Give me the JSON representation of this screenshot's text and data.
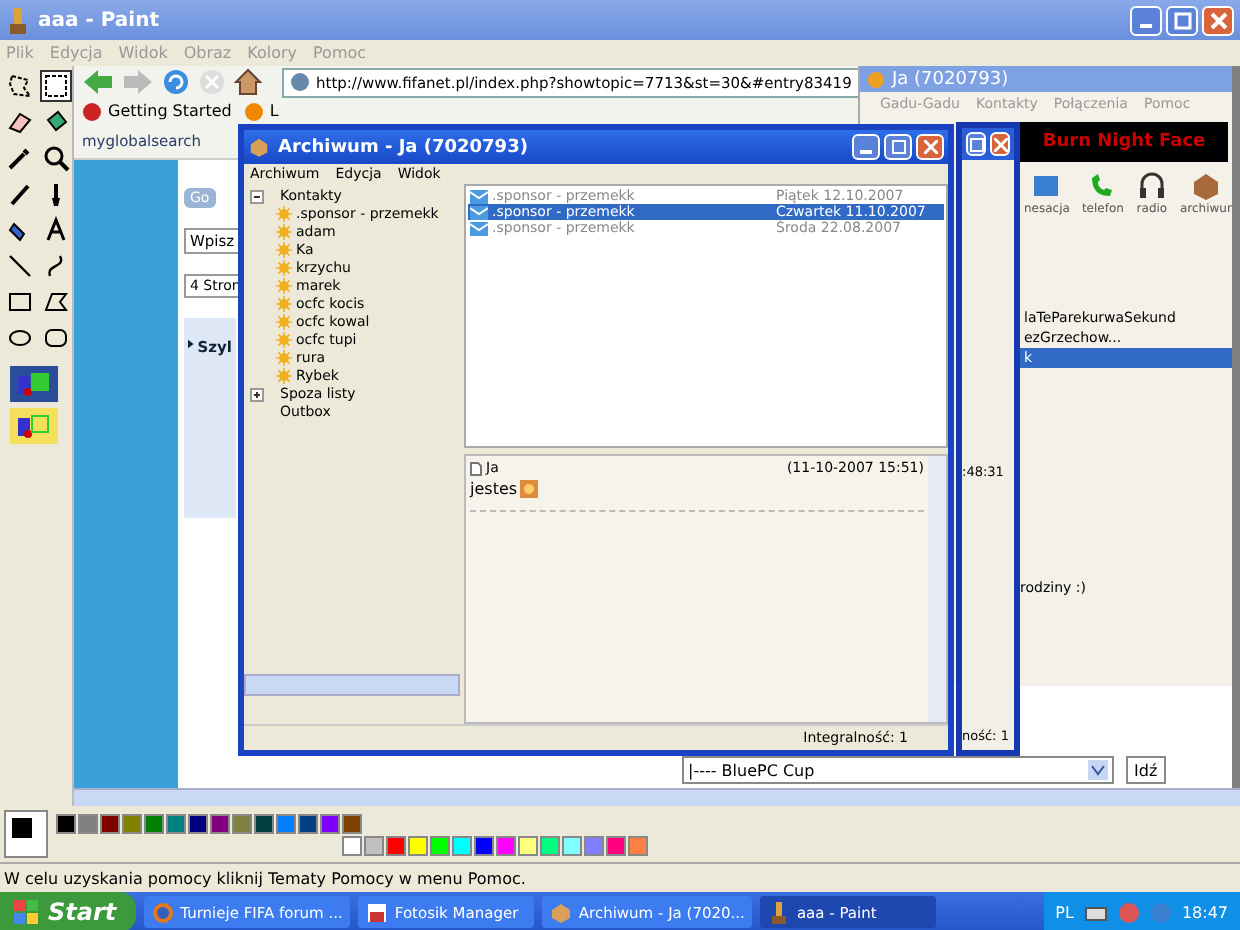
{
  "window": {
    "title": "aaa - Paint"
  },
  "menu": [
    "Plik",
    "Edycja",
    "Widok",
    "Obraz",
    "Kolory",
    "Pomoc"
  ],
  "tools": [
    {
      "kind": "free-select",
      "selected": false
    },
    {
      "kind": "select",
      "selected": true
    },
    {
      "kind": "eraser",
      "selected": false
    },
    {
      "kind": "fill",
      "selected": false
    },
    {
      "kind": "picker",
      "selected": false
    },
    {
      "kind": "magnifier",
      "selected": false
    },
    {
      "kind": "pencil",
      "selected": false
    },
    {
      "kind": "brush",
      "selected": false
    },
    {
      "kind": "airbrush",
      "selected": false
    },
    {
      "kind": "text",
      "selected": false
    },
    {
      "kind": "line",
      "selected": false
    },
    {
      "kind": "curve",
      "selected": false
    },
    {
      "kind": "rectangle",
      "selected": false
    },
    {
      "kind": "polygon",
      "selected": false
    },
    {
      "kind": "ellipse",
      "selected": false
    },
    {
      "kind": "rounded-rectangle",
      "selected": false
    }
  ],
  "transparency": [
    {
      "selected": true
    },
    {
      "selected": false
    }
  ],
  "canvas": {
    "browser": {
      "url": "http://www.fifanet.pl/index.php?showtopic=7713&st=30&#entry83419",
      "bookmarks": [
        {
          "label": "Getting Started"
        },
        {
          "label": "L"
        }
      ],
      "search_logo": "myglobalsearch",
      "go_button": "Go",
      "input_value": "Wpisz",
      "pages": "4 Stron",
      "heading": "Szyl",
      "forum_select": "|---- BluePC Cup",
      "jump_button": "Idź"
    },
    "gg_window": {
      "title": "Ja (7020793)",
      "menu": [
        "Gadu-Gadu",
        "Kontakty",
        "Połączenia",
        "Pomoc"
      ],
      "banner": "Burn Night Face",
      "toolbar": [
        {
          "label": "nesacja",
          "kind": "contacts"
        },
        {
          "label": "telefon",
          "kind": "phone"
        },
        {
          "label": "radio",
          "kind": "radio"
        },
        {
          "label": "archiwur",
          "kind": "archive"
        }
      ],
      "list": [
        {
          "name": "laTeParekurwaSekund",
          "selected": false
        },
        {
          "name": "ezGrzechow...",
          "selected": false
        },
        {
          "name": "k",
          "selected": true
        }
      ],
      "message": "rodziny :)"
    },
    "back_window": {
      "time": ":48:31",
      "status": "ność: 1"
    },
    "archive": {
      "title": "Archiwum - Ja (7020793)",
      "menu": [
        "Archiwum",
        "Edycja",
        "Widok"
      ],
      "tree": [
        {
          "label": "Kontakty",
          "expanded": true,
          "children": [
            {
              "label": ".sponsor - przemekk"
            },
            {
              "label": "adam"
            },
            {
              "label": "Ka"
            },
            {
              "label": "krzychu"
            },
            {
              "label": "marek"
            },
            {
              "label": "ocfc kocis"
            },
            {
              "label": "ocfc kowal"
            },
            {
              "label": "ocfc tupi"
            },
            {
              "label": "rura"
            },
            {
              "label": "Rybek"
            }
          ]
        },
        {
          "label": "Spoza listy",
          "expanded": false
        },
        {
          "label": "Outbox"
        }
      ],
      "conversations": [
        {
          "contact": ".sponsor - przemekk",
          "date": "Piątek 12.10.2007",
          "selected": false
        },
        {
          "contact": ".sponsor - przemekk",
          "date": "Czwartek 11.10.2007",
          "selected": true
        },
        {
          "contact": ".sponsor - przemekk",
          "date": "Środa 22.08.2007",
          "selected": false
        }
      ],
      "message": {
        "author": "Ja",
        "timestamp": "(11-10-2007 15:51)",
        "text": "jestes"
      },
      "status": "Integralność: 1"
    }
  },
  "palette": [
    {
      "color": "#000000"
    },
    {
      "color": "#808080"
    },
    {
      "color": "#800000"
    },
    {
      "color": "#808000"
    },
    {
      "color": "#008000"
    },
    {
      "color": "#008080"
    },
    {
      "color": "#000080"
    },
    {
      "color": "#800080"
    },
    {
      "color": "#808040"
    },
    {
      "color": "#004040"
    },
    {
      "color": "#0080ff"
    },
    {
      "color": "#004080"
    },
    {
      "color": "#8000ff"
    },
    {
      "color": "#804000"
    },
    {
      "color": "#ffffff"
    },
    {
      "color": "#c0c0c0"
    },
    {
      "color": "#ff0000"
    },
    {
      "color": "#ffff00"
    },
    {
      "color": "#00ff00"
    },
    {
      "color": "#00ffff"
    },
    {
      "color": "#0000ff"
    },
    {
      "color": "#ff00ff"
    },
    {
      "color": "#ffff80"
    },
    {
      "color": "#00ff80"
    },
    {
      "color": "#80ffff"
    },
    {
      "color": "#8080ff"
    },
    {
      "color": "#ff0080"
    },
    {
      "color": "#ff8040"
    }
  ],
  "status_bar": "W celu uzyskania pomocy kliknij Tematy Pomocy w menu Pomoc.",
  "taskbar": {
    "start": "Start",
    "tasks": [
      {
        "label": "Turnieje FIFA forum ...",
        "kind": "browser",
        "selected": false
      },
      {
        "label": "Fotosik Manager",
        "kind": "upload",
        "selected": false
      },
      {
        "label": "Archiwum - Ja (7020...",
        "kind": "archive",
        "selected": false
      },
      {
        "label": "aaa - Paint",
        "kind": "paint",
        "selected": true
      }
    ],
    "language": "PL",
    "clock": "18:47"
  }
}
